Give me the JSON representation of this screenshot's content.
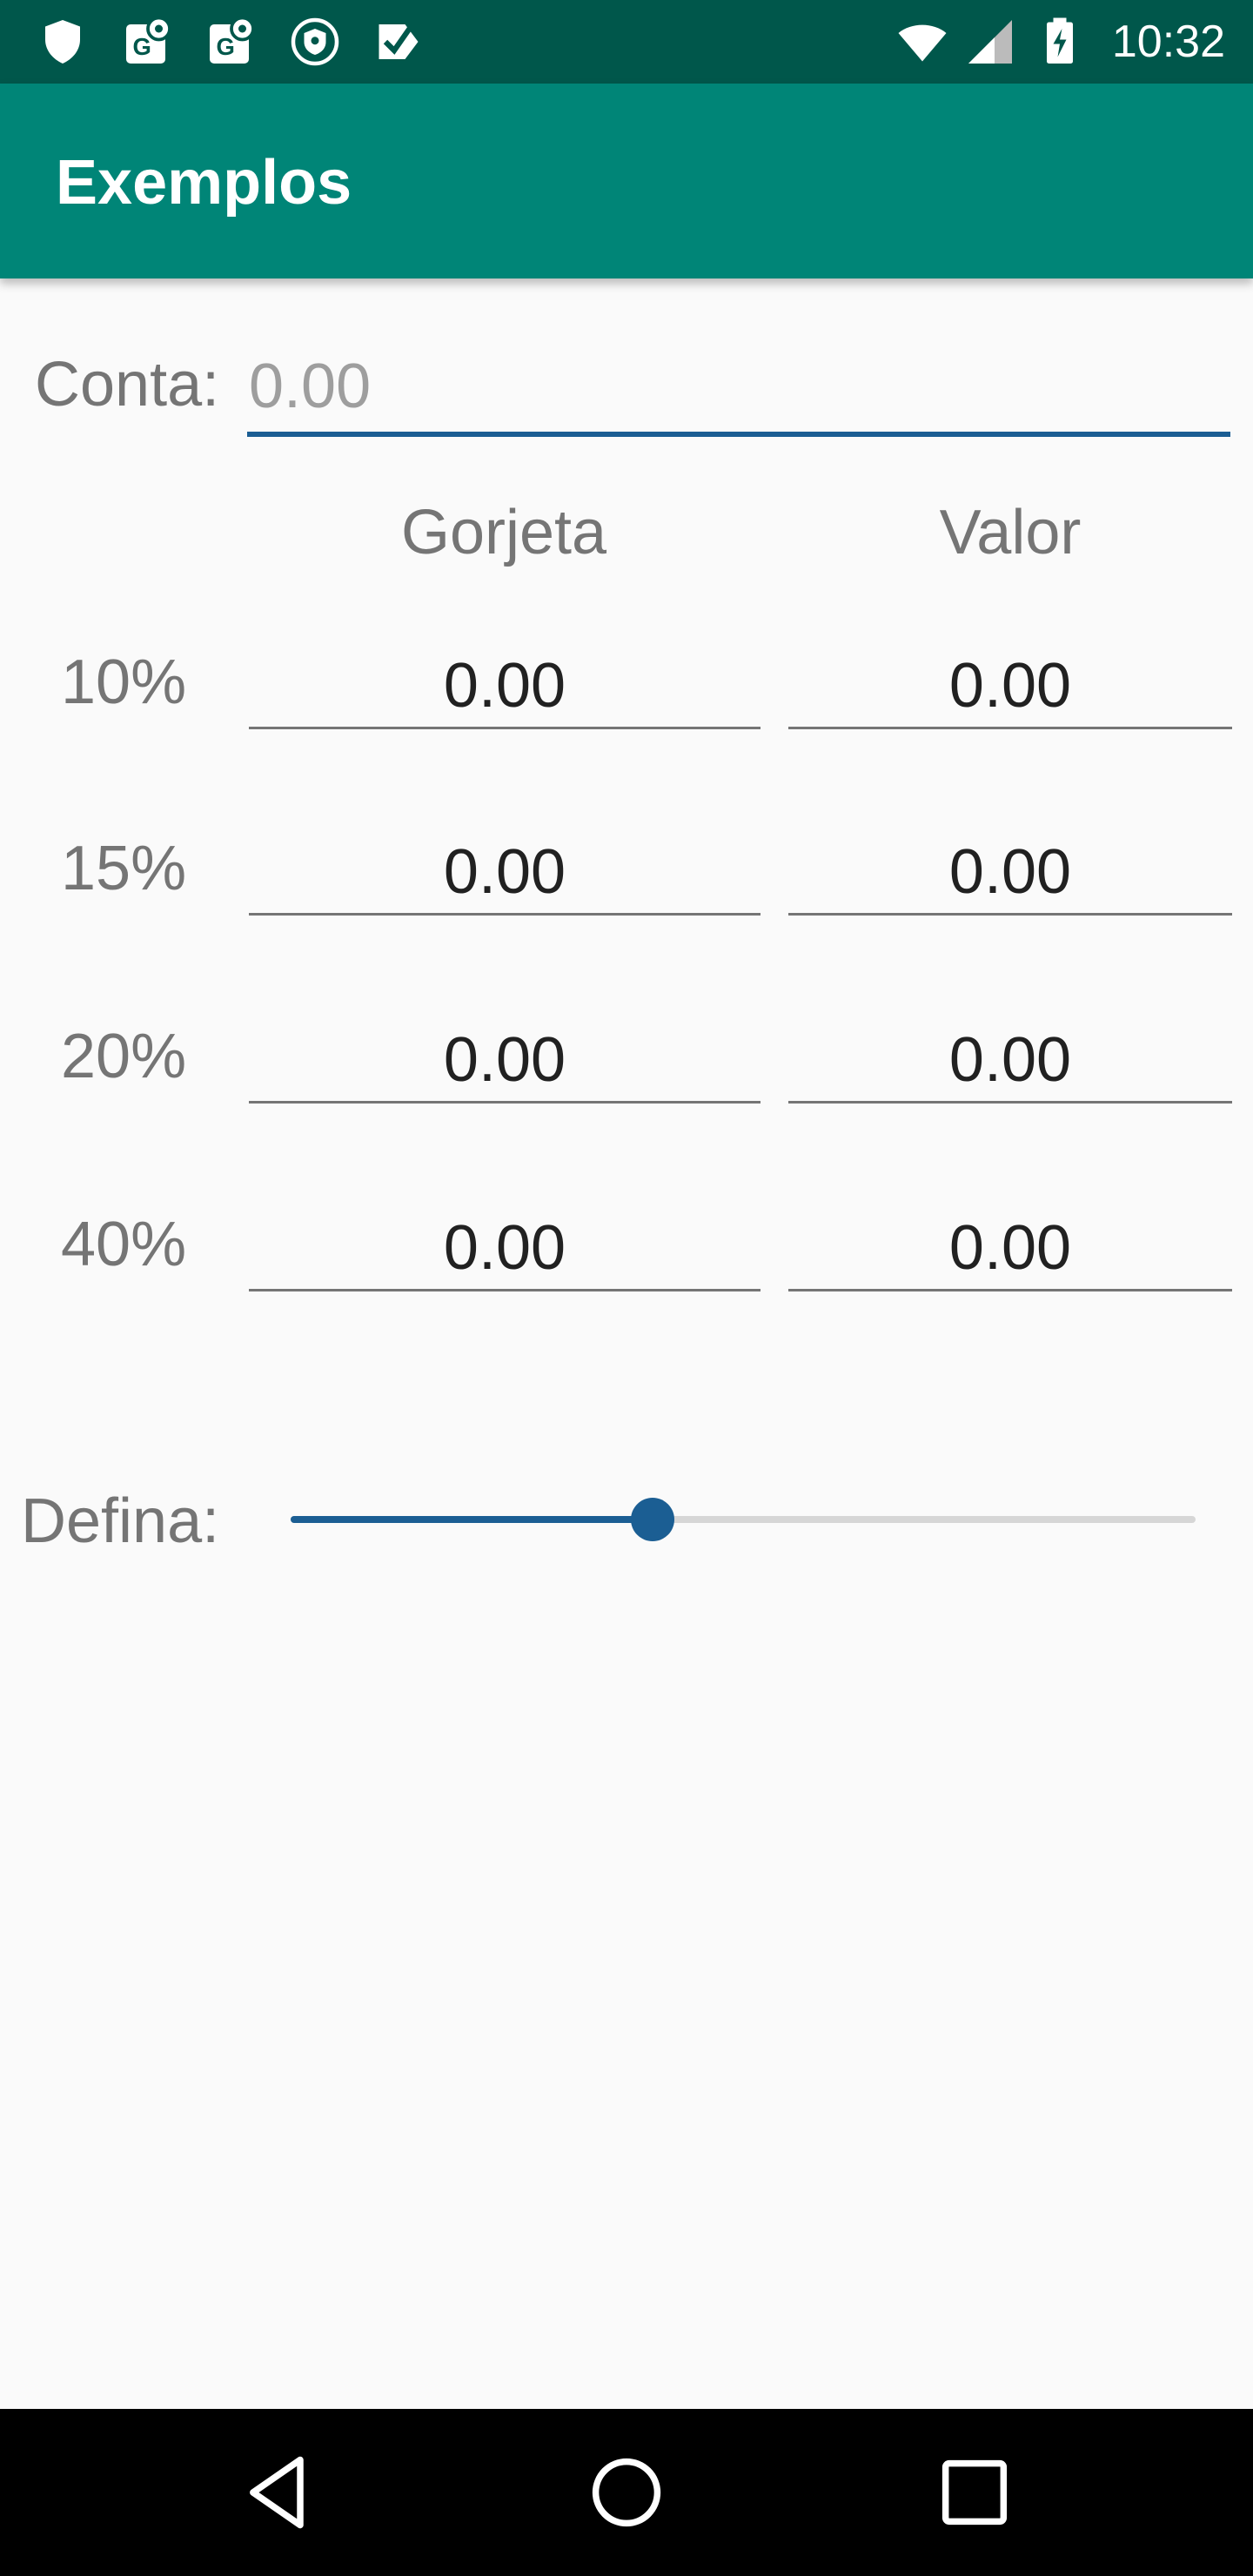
{
  "status_bar": {
    "time": "10:32",
    "icons": [
      "shield-icon",
      "maps-icon",
      "maps-icon",
      "shield-location-icon",
      "check-icon",
      "wifi-icon",
      "signal-icon",
      "battery-charging-icon"
    ]
  },
  "app_bar": {
    "title": "Exemplos"
  },
  "bill": {
    "label": "Conta:",
    "placeholder": "0.00",
    "value": ""
  },
  "columns": {
    "tip": "Gorjeta",
    "total": "Valor"
  },
  "rows": [
    {
      "percent": "10%",
      "tip": "0.00",
      "total": "0.00"
    },
    {
      "percent": "15%",
      "tip": "0.00",
      "total": "0.00"
    },
    {
      "percent": "20%",
      "tip": "0.00",
      "total": "0.00"
    },
    {
      "percent": "40%",
      "tip": "0.00",
      "total": "0.00"
    }
  ],
  "slider": {
    "label": "Defina:",
    "level": 0.4
  },
  "colors": {
    "status_bar": "#00574b",
    "app_bar": "#008577",
    "accent": "#1b5e93"
  },
  "navigation": [
    "back-icon",
    "home-icon",
    "recents-icon"
  ]
}
